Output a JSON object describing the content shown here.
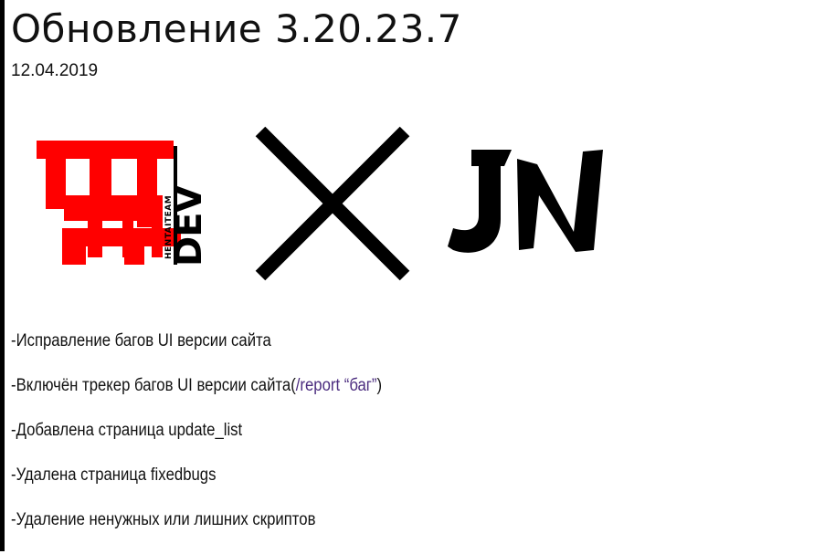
{
  "post": {
    "title": "Обновление 3.20.23.7",
    "date": "12.04.2019"
  },
  "logos": {
    "left_logo_label": "HENTAITEAM DEV",
    "right_logo_label": "JN",
    "colors": {
      "accent": "#ff0000",
      "ink": "#000000",
      "link": "#4b2c7f"
    }
  },
  "changes": [
    {
      "text": "-Исправление багов UI версии сайта"
    },
    {
      "text_before": "-Включён трекер багов UI версии сайта(",
      "link_text": "/report “баг”",
      "text_after": ")"
    },
    {
      "text": "-Добавлена страница update_list"
    },
    {
      "text": "-Удалена страница fixedbugs"
    },
    {
      "text": "-Удаление ненужных или лишних скриптов"
    }
  ]
}
